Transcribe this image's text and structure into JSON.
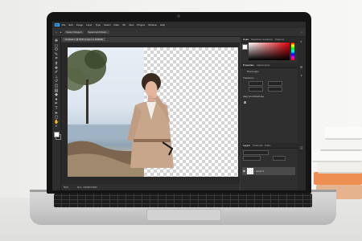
{
  "app": {
    "logo": "Ps",
    "menu": [
      "File",
      "Edit",
      "Image",
      "Layer",
      "Type",
      "Select",
      "Filter",
      "3D",
      "View",
      "Plugins",
      "Window",
      "Help"
    ]
  },
  "options_bar": {
    "select_subject": "Select Subject",
    "select_and_mask": "Select and Mask..."
  },
  "document": {
    "tab_title": "Untitled-1 @ 50% (Layer 0, RGB/8)",
    "zoom": "50%"
  },
  "status_bar": {
    "zoom": "50%",
    "doc_size": "Doc: 4.50M/4.50M"
  },
  "tools": [
    {
      "name": "move-tool-icon",
      "glyph": "✥"
    },
    {
      "name": "marquee-tool-icon",
      "glyph": "▭"
    },
    {
      "name": "lasso-tool-icon",
      "glyph": "ʘ"
    },
    {
      "name": "quick-selection-tool-icon",
      "glyph": "✎"
    },
    {
      "name": "crop-tool-icon",
      "glyph": "⌗"
    },
    {
      "name": "eyedropper-tool-icon",
      "glyph": "ɸ"
    },
    {
      "name": "healing-brush-tool-icon",
      "glyph": "✚"
    },
    {
      "name": "brush-tool-icon",
      "glyph": "✐"
    },
    {
      "name": "clone-stamp-tool-icon",
      "glyph": "⊥"
    },
    {
      "name": "history-brush-tool-icon",
      "glyph": "↺"
    },
    {
      "name": "eraser-tool-icon",
      "glyph": "◫"
    },
    {
      "name": "gradient-tool-icon",
      "glyph": "▤"
    },
    {
      "name": "blur-tool-icon",
      "glyph": "◆"
    },
    {
      "name": "dodge-tool-icon",
      "glyph": "●"
    },
    {
      "name": "pen-tool-icon",
      "glyph": "✒"
    },
    {
      "name": "type-tool-icon",
      "glyph": "T"
    },
    {
      "name": "path-selection-tool-icon",
      "glyph": "➤"
    },
    {
      "name": "shape-tool-icon",
      "glyph": "▢"
    },
    {
      "name": "hand-tool-icon",
      "glyph": "✋"
    },
    {
      "name": "zoom-tool-icon",
      "glyph": "⌕"
    }
  ],
  "panels": {
    "color_tabs": [
      "Color",
      "Swatches",
      "Gradients",
      "Patterns"
    ],
    "properties_tabs": [
      "Properties",
      "Adjustments"
    ],
    "properties": {
      "section": "Pixel Layer",
      "transform": "Transform",
      "align": "Align and Distribute"
    },
    "layers_tabs": [
      "Layers",
      "Channels",
      "Paths"
    ],
    "layer_name": "Layer 0"
  },
  "colors": {
    "accent": "#31a8ff",
    "panel_bg": "#2f2f2f",
    "color_picker_hue": "#e6000a"
  }
}
